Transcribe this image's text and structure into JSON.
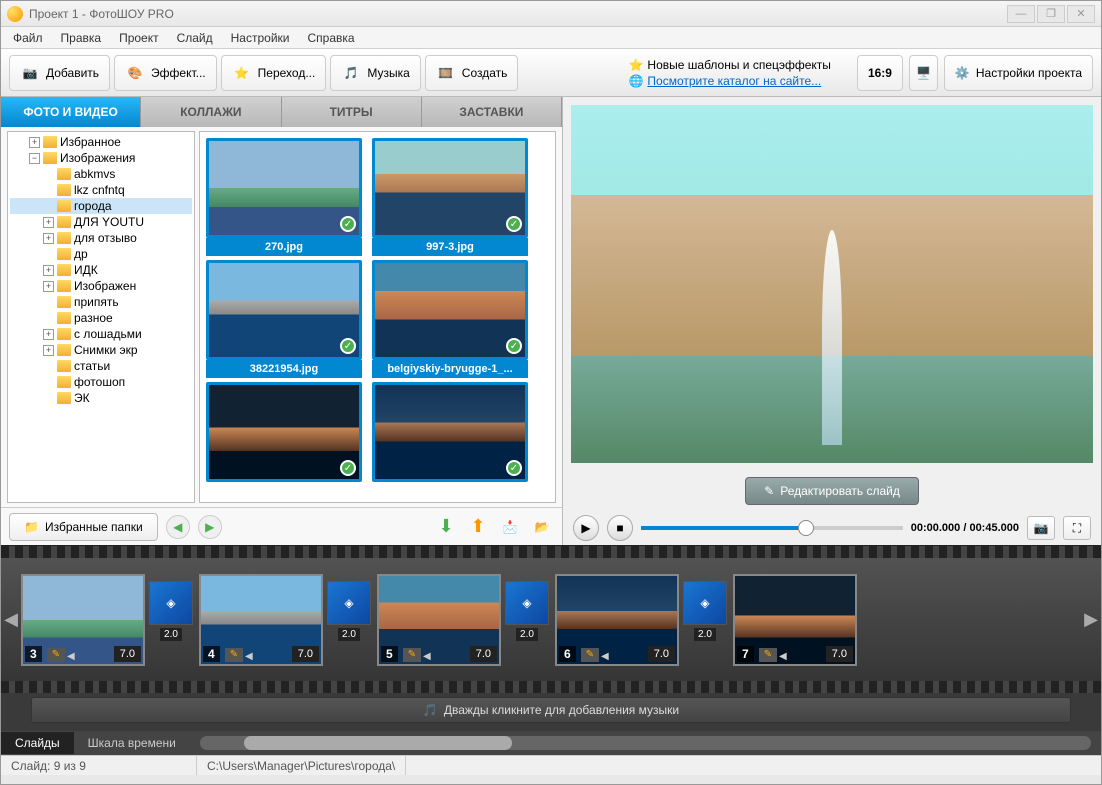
{
  "window": {
    "title": "Проект 1 - ФотоШОУ PRO"
  },
  "menu": [
    "Файл",
    "Правка",
    "Проект",
    "Слайд",
    "Настройки",
    "Справка"
  ],
  "toolbar": {
    "add": "Добавить",
    "effects": "Эффект...",
    "transitions": "Переход...",
    "music": "Музыка",
    "create": "Создать"
  },
  "tips": {
    "templates": "Новые шаблоны и спецэффекты",
    "catalog": "Посмотрите каталог на сайте..."
  },
  "aspect": "16:9",
  "settings": "Настройки проекта",
  "tabs": {
    "photo": "ФОТО И ВИДЕО",
    "collage": "КОЛЛАЖИ",
    "titles": "ТИТРЫ",
    "splash": "ЗАСТАВКИ"
  },
  "tree": [
    {
      "ind": 1,
      "exp": "+",
      "label": "Избранное"
    },
    {
      "ind": 1,
      "exp": "−",
      "label": "Изображения"
    },
    {
      "ind": 3,
      "label": "abkmvs"
    },
    {
      "ind": 3,
      "label": "lkz cnfntq"
    },
    {
      "ind": 3,
      "label": "города",
      "sel": true
    },
    {
      "ind": 2,
      "exp": "+",
      "label": "ДЛЯ YOUTU"
    },
    {
      "ind": 2,
      "exp": "+",
      "label": "для отзыво"
    },
    {
      "ind": 3,
      "label": "др"
    },
    {
      "ind": 2,
      "exp": "+",
      "label": "ИДК"
    },
    {
      "ind": 2,
      "exp": "+",
      "label": "Изображен"
    },
    {
      "ind": 3,
      "label": "припять"
    },
    {
      "ind": 3,
      "label": "разное"
    },
    {
      "ind": 2,
      "exp": "+",
      "label": "с лошадьми"
    },
    {
      "ind": 2,
      "exp": "+",
      "label": "Снимки экр"
    },
    {
      "ind": 3,
      "label": "статьи"
    },
    {
      "ind": 3,
      "label": "фотошоп"
    },
    {
      "ind": 3,
      "label": "ЭК"
    }
  ],
  "thumbs": [
    {
      "name": "270.jpg",
      "c": "city1"
    },
    {
      "name": "997-3.jpg",
      "c": "city2"
    },
    {
      "name": "38221954.jpg",
      "c": "city3"
    },
    {
      "name": "belgiyskiy-bryugge-1_...",
      "c": "city4"
    },
    {
      "name": "",
      "c": "city5"
    },
    {
      "name": "",
      "c": "city6"
    }
  ],
  "favfolders": "Избранные папки",
  "editslide": "Редактировать слайд",
  "time": "00:00.000 / 00:45.000",
  "slides": [
    {
      "n": "3",
      "dur": "7.0",
      "c": "city1",
      "t": "2.0"
    },
    {
      "n": "4",
      "dur": "7.0",
      "c": "city3",
      "t": "2.0"
    },
    {
      "n": "5",
      "dur": "7.0",
      "c": "city4",
      "t": "2.0"
    },
    {
      "n": "6",
      "dur": "7.0",
      "c": "city6",
      "t": "2.0"
    },
    {
      "n": "7",
      "dur": "7.0",
      "c": "city5"
    }
  ],
  "musichint": "Дважды кликните для добавления музыки",
  "tltabs": {
    "slides": "Слайды",
    "timeline": "Шкала времени"
  },
  "status": {
    "slide": "Слайд: 9 из 9",
    "path": "C:\\Users\\Manager\\Pictures\\города\\"
  }
}
